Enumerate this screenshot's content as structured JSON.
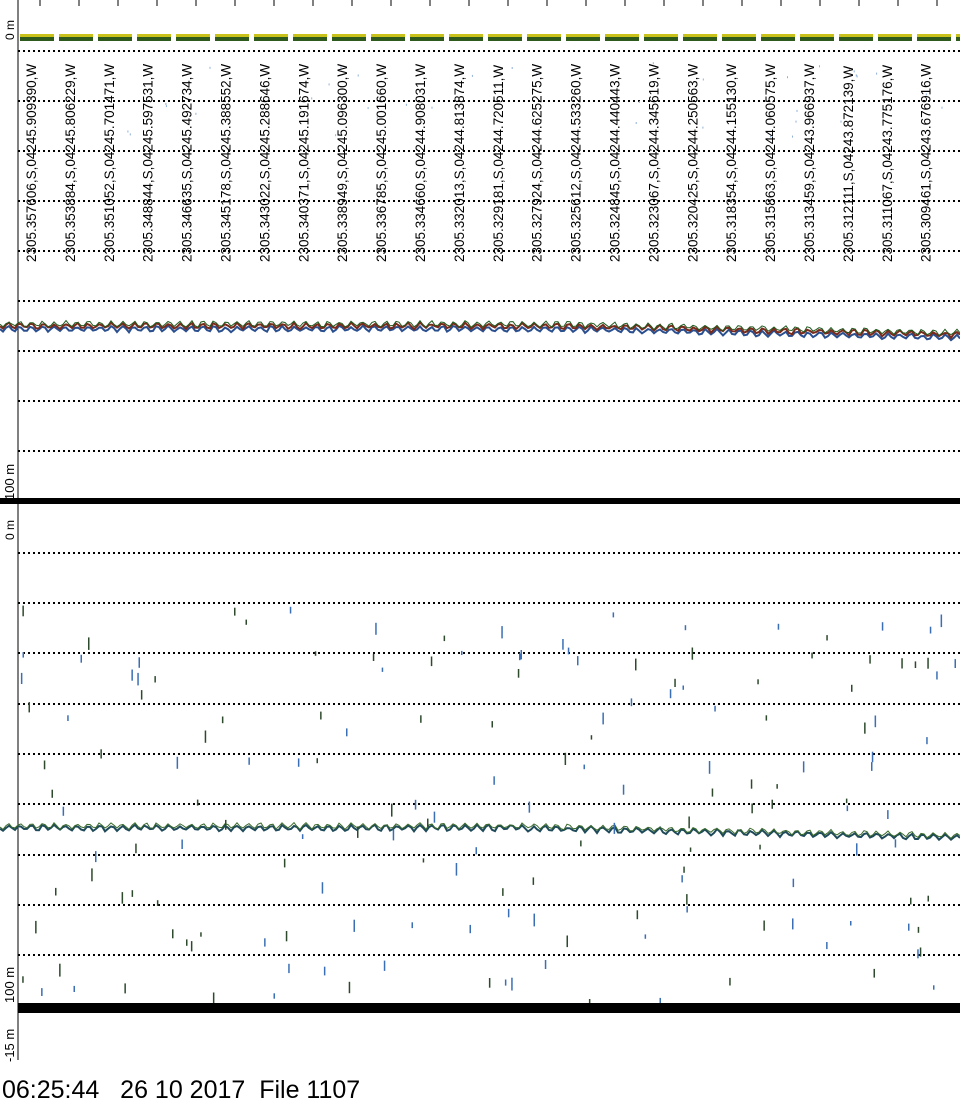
{
  "upper_panel": {
    "depth_top_label": "0 m",
    "depth_scale_label": "100 m"
  },
  "lower_panel": {
    "depth_top_label": "0 m",
    "depth_scale_label": "100 m",
    "depth_bottom_label": "-15 m"
  },
  "position_strings": [
    "2305.357606,S,04245.909390,W",
    "2305.353884,S,04245.806229,W",
    "2305.351052,S,04245.701471,W",
    "2305.348844,S,04245.597531,W",
    "2305.346635,S,04245.492734,W",
    "2305.345178,S,04245.388552,W",
    "2305.343022,S,04245.288646,W",
    "2305.340371,S,04245.191674,W",
    "2305.338949,S,04245.096300,W",
    "2305.336785,S,04245.001660,W",
    "2305.334660,S,04244.908031,W",
    "2305.332013,S,04244.813874,W",
    "2305.329181,S,04244.720511,W",
    "2305.327924,S,04244.625275,W",
    "2305.325612,S,04244.533260,W",
    "2305.324845,S,04244.440443,W",
    "2305.323067,S,04244.345619,W",
    "2305.320425,S,04244.250563,W",
    "2305.318354,S,04244.155130,W",
    "2305.315863,S,04244.060575,W",
    "2305.313459,S,04243.966937,W",
    "2305.312111,S,04243.872139,W",
    "2305.311067,S,04243.775176,W",
    "2305.309461,S,04243.676916,W"
  ],
  "footer": {
    "time": "06:25:44",
    "date": "26 10 2017",
    "file": "File 1107"
  },
  "colors": {
    "surface_green": "#2f5a1e",
    "surface_yellow": "#c9c21a",
    "bottom_red": "#7a2a1a",
    "bottom_blue": "#2a4f8f",
    "scatter_blue": "#3b6fb5",
    "axis_black": "#000000"
  }
}
